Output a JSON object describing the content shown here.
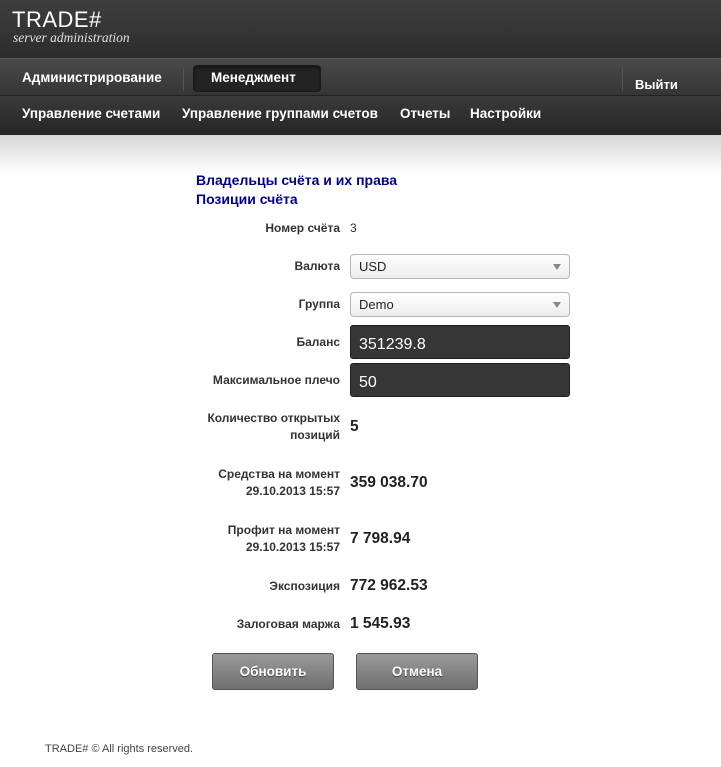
{
  "logo": {
    "title": "TRADE#",
    "subtitle": "server administration"
  },
  "top_nav": {
    "admin": "Администрирование",
    "management": "Менеджмент",
    "logout": "Выйти"
  },
  "sub_nav": {
    "accounts": "Управление счетами",
    "groups": "Управление группами счетов",
    "reports": "Отчеты",
    "settings": "Настройки"
  },
  "links": {
    "owners": "Владельцы счёта и их права",
    "positions": "Позиции счёта"
  },
  "form": {
    "account_number_label": "Номер счёта",
    "account_number": "3",
    "currency_label": "Валюта",
    "currency_value": "USD",
    "group_label": "Группа",
    "group_value": "Demo",
    "balance_label": "Баланс",
    "balance_value": "351239.8",
    "leverage_label": "Максимальное плечо",
    "leverage_value": "50",
    "open_positions_label_1": "Количество открытых",
    "open_positions_label_2": "позиций",
    "open_positions": "5",
    "equity_label_1": "Средства на момент",
    "equity_label_2": "29.10.2013 15:57",
    "equity": "359 038.70",
    "profit_label_1": "Профит на момент",
    "profit_label_2": "29.10.2013 15:57",
    "profit": "7 798.94",
    "exposure_label": "Экспозиция",
    "exposure": "772 962.53",
    "margin_label": "Залоговая маржа",
    "margin": "1 545.93"
  },
  "buttons": {
    "update": "Обновить",
    "cancel": "Отмена"
  },
  "footer": "TRADE# © All rights reserved."
}
